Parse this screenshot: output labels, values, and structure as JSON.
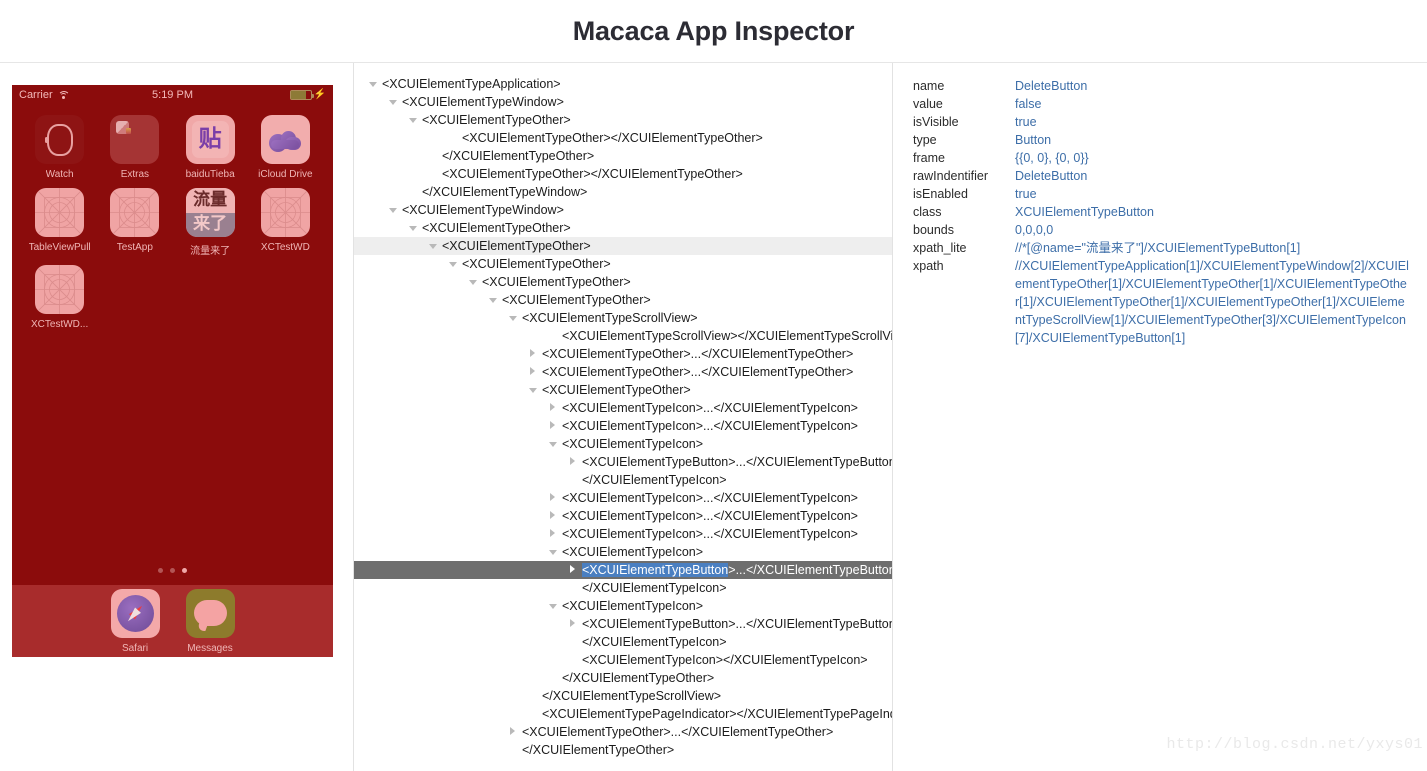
{
  "header": {
    "title": "Macaca App Inspector"
  },
  "device": {
    "status_bar": {
      "carrier": "Carrier",
      "wifi_icon": "wifi-icon",
      "time": "5:19 PM",
      "battery_icon": "battery-icon",
      "charging_icon": "lightning-bolt-icon"
    },
    "apps": [
      {
        "label": "Watch",
        "icon": "watch-icon"
      },
      {
        "label": "Extras",
        "icon": "extras-icon"
      },
      {
        "label": "baiduTieba",
        "icon": "baidu-tieba-icon",
        "glyph": "贴"
      },
      {
        "label": "iCloud Drive",
        "icon": "icloud-drive-icon"
      },
      {
        "label": "TableViewPull",
        "icon": "placeholder-app-icon"
      },
      {
        "label": "TestApp",
        "icon": "placeholder-app-icon"
      },
      {
        "label": "流量来了",
        "icon": "liuliang-icon",
        "glyph_top": "流量",
        "glyph_bottom": "来了"
      },
      {
        "label": "XCTestWD",
        "icon": "placeholder-app-icon"
      },
      {
        "label": "XCTestWD...",
        "icon": "placeholder-app-icon"
      }
    ],
    "page_dots": {
      "count": 3,
      "active_index": 2
    },
    "dock": [
      {
        "label": "Safari",
        "icon": "safari-icon"
      },
      {
        "label": "Messages",
        "icon": "messages-icon"
      }
    ]
  },
  "tree": {
    "rows": [
      {
        "indent": 0,
        "twisty": "down",
        "text": "<XCUIElementTypeApplication>"
      },
      {
        "indent": 1,
        "twisty": "down",
        "text": "<XCUIElementTypeWindow>"
      },
      {
        "indent": 2,
        "twisty": "down",
        "text": "<XCUIElementTypeOther>"
      },
      {
        "indent": 4,
        "twisty": "none",
        "text": "<XCUIElementTypeOther></XCUIElementTypeOther>"
      },
      {
        "indent": 3,
        "twisty": "none",
        "text": "</XCUIElementTypeOther>"
      },
      {
        "indent": 3,
        "twisty": "none",
        "text": "<XCUIElementTypeOther></XCUIElementTypeOther>"
      },
      {
        "indent": 2,
        "twisty": "none",
        "text": "</XCUIElementTypeWindow>"
      },
      {
        "indent": 1,
        "twisty": "down",
        "text": "<XCUIElementTypeWindow>"
      },
      {
        "indent": 2,
        "twisty": "down",
        "text": "<XCUIElementTypeOther>"
      },
      {
        "indent": 3,
        "twisty": "down",
        "text": "<XCUIElementTypeOther>",
        "state": "hover"
      },
      {
        "indent": 4,
        "twisty": "down",
        "text": "<XCUIElementTypeOther>"
      },
      {
        "indent": 5,
        "twisty": "down",
        "text": "<XCUIElementTypeOther>"
      },
      {
        "indent": 6,
        "twisty": "down",
        "text": "<XCUIElementTypeOther>"
      },
      {
        "indent": 7,
        "twisty": "down",
        "text": "<XCUIElementTypeScrollView>"
      },
      {
        "indent": 9,
        "twisty": "none",
        "text": "<XCUIElementTypeScrollView></XCUIElementTypeScrollView>"
      },
      {
        "indent": 8,
        "twisty": "right",
        "text": "<XCUIElementTypeOther>...</XCUIElementTypeOther>"
      },
      {
        "indent": 8,
        "twisty": "right",
        "text": "<XCUIElementTypeOther>...</XCUIElementTypeOther>"
      },
      {
        "indent": 8,
        "twisty": "down",
        "text": "<XCUIElementTypeOther>"
      },
      {
        "indent": 9,
        "twisty": "right",
        "text": "<XCUIElementTypeIcon>...</XCUIElementTypeIcon>"
      },
      {
        "indent": 9,
        "twisty": "right",
        "text": "<XCUIElementTypeIcon>...</XCUIElementTypeIcon>"
      },
      {
        "indent": 9,
        "twisty": "down",
        "text": "<XCUIElementTypeIcon>"
      },
      {
        "indent": 10,
        "twisty": "right",
        "text": "<XCUIElementTypeButton>...</XCUIElementTypeButton>"
      },
      {
        "indent": 10,
        "twisty": "none",
        "text": "</XCUIElementTypeIcon>"
      },
      {
        "indent": 9,
        "twisty": "right",
        "text": "<XCUIElementTypeIcon>...</XCUIElementTypeIcon>"
      },
      {
        "indent": 9,
        "twisty": "right",
        "text": "<XCUIElementTypeIcon>...</XCUIElementTypeIcon>"
      },
      {
        "indent": 9,
        "twisty": "right",
        "text": "<XCUIElementTypeIcon>...</XCUIElementTypeIcon>"
      },
      {
        "indent": 9,
        "twisty": "down",
        "text": "<XCUIElementTypeIcon>"
      },
      {
        "indent": 10,
        "twisty": "right",
        "text": "<XCUIElementTypeButton>...</XCUIElementTypeButton>",
        "state": "selected",
        "highlight": "<XCUIElementTypeButton"
      },
      {
        "indent": 10,
        "twisty": "none",
        "text": "</XCUIElementTypeIcon>"
      },
      {
        "indent": 9,
        "twisty": "down",
        "text": "<XCUIElementTypeIcon>"
      },
      {
        "indent": 10,
        "twisty": "right",
        "text": "<XCUIElementTypeButton>...</XCUIElementTypeButton>"
      },
      {
        "indent": 10,
        "twisty": "none",
        "text": "</XCUIElementTypeIcon>"
      },
      {
        "indent": 10,
        "twisty": "none",
        "text": "<XCUIElementTypeIcon></XCUIElementTypeIcon>"
      },
      {
        "indent": 9,
        "twisty": "none",
        "text": "</XCUIElementTypeOther>"
      },
      {
        "indent": 8,
        "twisty": "none",
        "text": "</XCUIElementTypeScrollView>"
      },
      {
        "indent": 8,
        "twisty": "none",
        "text": "<XCUIElementTypePageIndicator></XCUIElementTypePageIndicator>"
      },
      {
        "indent": 7,
        "twisty": "right",
        "text": "<XCUIElementTypeOther>...</XCUIElementTypeOther>"
      },
      {
        "indent": 7,
        "twisty": "none",
        "text": "</XCUIElementTypeOther>"
      }
    ]
  },
  "details": {
    "rows": [
      {
        "key": "name",
        "value": "DeleteButton"
      },
      {
        "key": "value",
        "value": "false"
      },
      {
        "key": "isVisible",
        "value": "true"
      },
      {
        "key": "type",
        "value": "Button"
      },
      {
        "key": "frame",
        "value": "{{0, 0}, {0, 0}}"
      },
      {
        "key": "rawIndentifier",
        "value": "DeleteButton"
      },
      {
        "key": "isEnabled",
        "value": "true"
      },
      {
        "key": "class",
        "value": "XCUIElementTypeButton"
      },
      {
        "key": "bounds",
        "value": "0,0,0,0"
      },
      {
        "key": "xpath_lite",
        "value": "//*[@name=\"流量来了\"]/XCUIElementTypeButton[1]"
      },
      {
        "key": "xpath",
        "value": "//XCUIElementTypeApplication[1]/XCUIElementTypeWindow[2]/XCUIElementTypeOther[1]/XCUIElementTypeOther[1]/XCUIElementTypeOther[1]/XCUIElementTypeOther[1]/XCUIElementTypeOther[1]/XCUIElementTypeScrollView[1]/XCUIElementTypeOther[3]/XCUIElementTypeIcon[7]/XCUIElementTypeButton[1]"
      }
    ]
  },
  "watermark": {
    "text": "http://blog.csdn.net/yxys01"
  },
  "colors": {
    "device_background": "#8b0c0c",
    "dock_background": "#a82c2c",
    "selected_row": "#6e6e6e",
    "hover_row": "#eeeeee",
    "selection_highlight": "#4a7fc1",
    "detail_value": "#3d6ea8",
    "title": "#2c2c34"
  }
}
